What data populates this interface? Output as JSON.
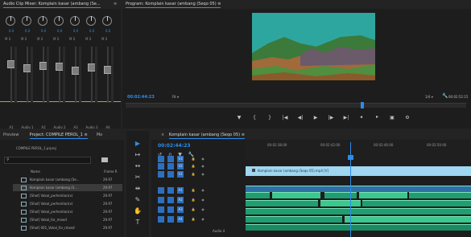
{
  "mixer": {
    "title": "Audio Clip Mixer: Komplain kasar (ambang (Se...",
    "channel_values": [
      "0.0",
      "0.0",
      "0.0",
      "0.0",
      "0.0",
      "0.0",
      "0.0"
    ],
    "channel_labels": [
      "A1",
      "Audio 1",
      "A2",
      "Audio 2",
      "A3",
      "Audio 3",
      "A4"
    ],
    "fader_levels": [
      0.72,
      0.65,
      0.7,
      0.68,
      0.6,
      0.66,
      0.62
    ],
    "meter_levels": [
      0.0,
      0.0,
      0.0,
      0.0,
      0.0,
      0.0,
      0.0
    ]
  },
  "program": {
    "title": "Program: Komplain kasar (ambang (Seqo 05) ≡",
    "timecode": "00:02:44:23",
    "fit": "Fit",
    "quality": "1/4",
    "duration": "00:02:52:15",
    "playhead_position": 0.69,
    "transport_icons": [
      "marker-icon",
      "in-point-icon",
      "out-point-icon",
      "go-to-in-icon",
      "step-back-icon",
      "play-icon",
      "step-forward-icon",
      "go-to-out-icon",
      "insert-icon",
      "overwrite-icon",
      "export-frame-icon",
      "settings-icon"
    ]
  },
  "project": {
    "tabs": [
      "Preview",
      "Project: COMPILE PEROL_1 ≡",
      "Me"
    ],
    "bin_name": "COMPILE PEROL_1.prproj",
    "column_name": "Name",
    "column_rate": "Frame R",
    "items": [
      {
        "name": "Komplain kasar (ambang (Se...",
        "rate": "29.97",
        "color": "#1fb36a"
      },
      {
        "name": "Komplain kasar (ambang (S...",
        "rate": "29.97",
        "color": "#6fb3e8"
      },
      {
        "name": "[Shot] Vokal_perhentian(v)",
        "rate": "29.97",
        "color": "#1fb36a"
      },
      {
        "name": "[Shot] Vokal_perhentian(v)",
        "rate": "29.97",
        "color": "#1fb36a"
      },
      {
        "name": "[Shot] Vokal_perhentian(v)",
        "rate": "29.97",
        "color": "#1fb36a"
      },
      {
        "name": "[Shot] Vokal_for_mixed",
        "rate": "29.97",
        "color": "#1fb36a"
      },
      {
        "name": "[Shot] 001_Vokal_for_mixed",
        "rate": "29.97",
        "color": "#1fb36a"
      }
    ]
  },
  "tools": [
    "selection-icon",
    "track-select-icon",
    "ripple-edit-icon",
    "razor-icon",
    "slip-icon",
    "pen-icon",
    "hand-icon",
    "type-icon"
  ],
  "timeline": {
    "title": "Komplain kasar (ambang (Seqo 05) ≡",
    "timecode": "00:02:44:23",
    "ruler_labels": [
      "00:02:38:00",
      "00:02:42:00",
      "00:02:46:00",
      "00:02:50:00"
    ],
    "clip_title": "Komplain kasar (ambang (Seqo 05).mp4 [V]",
    "track_names": [
      "V3",
      "V2",
      "V1",
      "A1",
      "A2",
      "A3",
      "A4"
    ],
    "audio_label": "Audio 4"
  },
  "colors": {
    "accent": "#2d8ceb",
    "clip_video": "#9fd6f0",
    "clip_audio": "#1f9e72",
    "clip_audio_bright": "#37c98e",
    "project_swatch": "#1fb36a"
  }
}
